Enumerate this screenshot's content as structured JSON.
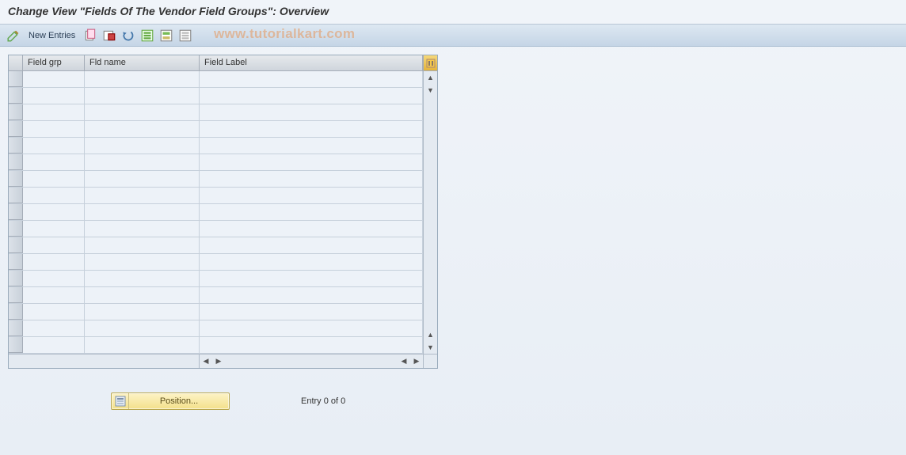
{
  "title": "Change View \"Fields Of The Vendor Field Groups\": Overview",
  "toolbar": {
    "new_entries_label": "New Entries"
  },
  "watermark": "www.tutorialkart.com",
  "grid": {
    "columns": {
      "c1": "Field grp",
      "c2": "Fld name",
      "c3": "Field Label"
    },
    "row_count": 17
  },
  "footer": {
    "position_label": "Position...",
    "entry_text": "Entry 0 of 0"
  }
}
